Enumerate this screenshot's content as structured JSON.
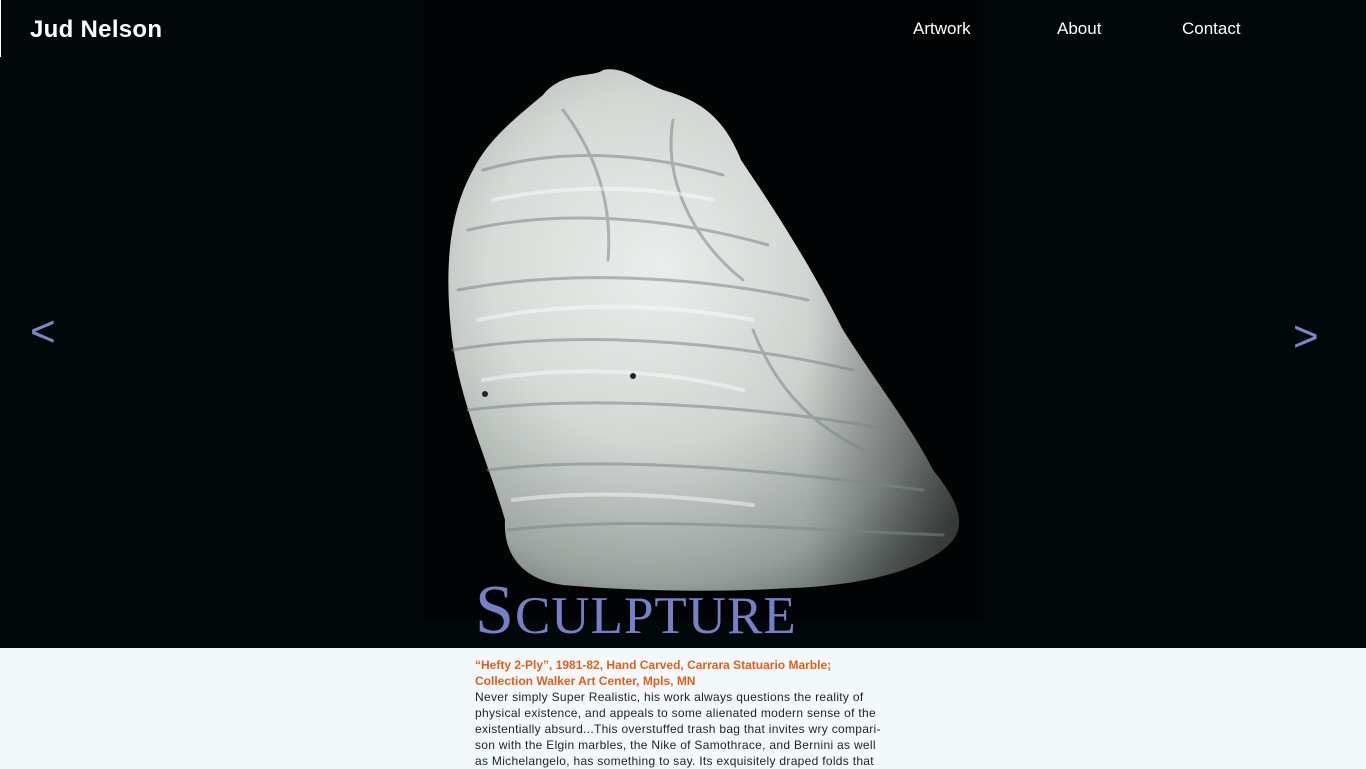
{
  "site": {
    "brand": "Jud Nelson"
  },
  "nav": {
    "items": [
      "Artwork",
      "About",
      "Contact"
    ]
  },
  "carousel": {
    "prev_label": "<",
    "next_label": ">"
  },
  "section": {
    "title_first": "S",
    "title_rest": "CULPTURE"
  },
  "artwork": {
    "credit_line1": "“Hefty 2-Ply”, 1981-82, Hand Carved, Carrara Statuario Marble;",
    "credit_line2": "Collection Walker Art Center, Mpls, MN",
    "description_lines": [
      "Never simply Super Realistic, his work always questions the reality of",
      "physical existence, and appeals to some alienated modern sense of the",
      "existentially absurd...This overstuffed trash bag that invites wry compari-",
      "son with the Elgin marbles, the Nike of Samothrace, and Bernini as well",
      "as Michelangelo, has something to say. Its exquisitely draped folds that"
    ]
  },
  "colors": {
    "accent": "#7580c6",
    "credit": "#e0601c",
    "hero_bg": "#02070a",
    "body_bg": "#f3f8fa"
  }
}
